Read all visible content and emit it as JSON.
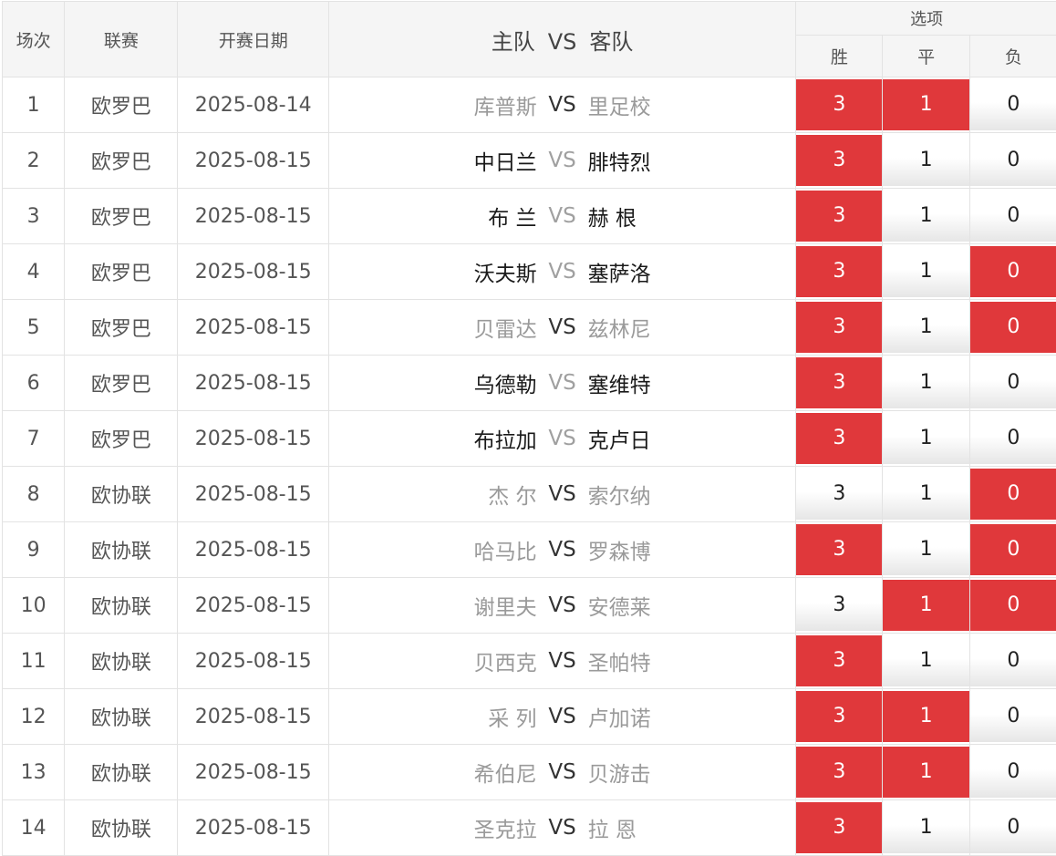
{
  "header": {
    "no": "场次",
    "league": "联赛",
    "date": "开赛日期",
    "home": "主队",
    "vs": "VS",
    "away": "客队",
    "options": "选项",
    "win": "胜",
    "draw": "平",
    "lose": "负"
  },
  "colors": {
    "selected_bg": "#e0383b",
    "selected_fg": "#ffffff"
  },
  "rows": [
    {
      "no": "1",
      "league": "欧罗巴",
      "date": "2025-08-14",
      "home": "库普斯",
      "vs": "VS",
      "away": "里足校",
      "emph": "away_vs",
      "win": "3",
      "draw": "1",
      "lose": "0",
      "sel": [
        true,
        true,
        false
      ]
    },
    {
      "no": "2",
      "league": "欧罗巴",
      "date": "2025-08-15",
      "home": "中日兰",
      "vs": "VS",
      "away": "腓特烈",
      "emph": "both",
      "win": "3",
      "draw": "1",
      "lose": "0",
      "sel": [
        true,
        false,
        false
      ]
    },
    {
      "no": "3",
      "league": "欧罗巴",
      "date": "2025-08-15",
      "home": "布 兰",
      "vs": "VS",
      "away": "赫 根",
      "emph": "both",
      "win": "3",
      "draw": "1",
      "lose": "0",
      "sel": [
        true,
        false,
        false
      ]
    },
    {
      "no": "4",
      "league": "欧罗巴",
      "date": "2025-08-15",
      "home": "沃夫斯",
      "vs": "VS",
      "away": "塞萨洛",
      "emph": "both",
      "win": "3",
      "draw": "1",
      "lose": "0",
      "sel": [
        true,
        false,
        true
      ]
    },
    {
      "no": "5",
      "league": "欧罗巴",
      "date": "2025-08-15",
      "home": "贝雷达",
      "vs": "VS",
      "away": "兹林尼",
      "emph": "vs_only",
      "win": "3",
      "draw": "1",
      "lose": "0",
      "sel": [
        true,
        false,
        true
      ]
    },
    {
      "no": "6",
      "league": "欧罗巴",
      "date": "2025-08-15",
      "home": "乌德勒",
      "vs": "VS",
      "away": "塞维特",
      "emph": "both",
      "win": "3",
      "draw": "1",
      "lose": "0",
      "sel": [
        true,
        false,
        false
      ]
    },
    {
      "no": "7",
      "league": "欧罗巴",
      "date": "2025-08-15",
      "home": "布拉加",
      "vs": "VS",
      "away": "克卢日",
      "emph": "both",
      "win": "3",
      "draw": "1",
      "lose": "0",
      "sel": [
        true,
        false,
        false
      ]
    },
    {
      "no": "8",
      "league": "欧协联",
      "date": "2025-08-15",
      "home": "杰 尔",
      "vs": "VS",
      "away": "索尔纳",
      "emph": "vs_only",
      "win": "3",
      "draw": "1",
      "lose": "0",
      "sel": [
        false,
        false,
        true
      ]
    },
    {
      "no": "9",
      "league": "欧协联",
      "date": "2025-08-15",
      "home": "哈马比",
      "vs": "VS",
      "away": "罗森博",
      "emph": "vs_only",
      "win": "3",
      "draw": "1",
      "lose": "0",
      "sel": [
        true,
        false,
        true
      ]
    },
    {
      "no": "10",
      "league": "欧协联",
      "date": "2025-08-15",
      "home": "谢里夫",
      "vs": "VS",
      "away": "安德莱",
      "emph": "vs_only",
      "win": "3",
      "draw": "1",
      "lose": "0",
      "sel": [
        false,
        true,
        true
      ]
    },
    {
      "no": "11",
      "league": "欧协联",
      "date": "2025-08-15",
      "home": "贝西克",
      "vs": "VS",
      "away": "圣帕特",
      "emph": "vs_only",
      "win": "3",
      "draw": "1",
      "lose": "0",
      "sel": [
        true,
        false,
        false
      ]
    },
    {
      "no": "12",
      "league": "欧协联",
      "date": "2025-08-15",
      "home": "采 列",
      "vs": "VS",
      "away": "卢加诺",
      "emph": "vs_only",
      "win": "3",
      "draw": "1",
      "lose": "0",
      "sel": [
        true,
        true,
        false
      ]
    },
    {
      "no": "13",
      "league": "欧协联",
      "date": "2025-08-15",
      "home": "希伯尼",
      "vs": "VS",
      "away": "贝游击",
      "emph": "vs_only",
      "win": "3",
      "draw": "1",
      "lose": "0",
      "sel": [
        true,
        true,
        false
      ]
    },
    {
      "no": "14",
      "league": "欧协联",
      "date": "2025-08-15",
      "home": "圣克拉",
      "vs": "VS",
      "away": "拉 恩",
      "emph": "vs_only",
      "win": "3",
      "draw": "1",
      "lose": "0",
      "sel": [
        true,
        false,
        false
      ]
    }
  ]
}
